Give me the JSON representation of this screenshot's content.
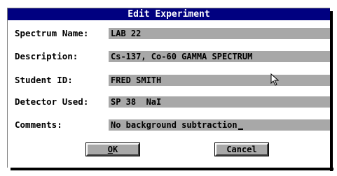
{
  "dialog": {
    "title": "Edit Experiment"
  },
  "fields": [
    {
      "label": "Spectrum Name:",
      "value": "LAB 22"
    },
    {
      "label": "Description:",
      "value": "Cs-137, Co-60 GAMMA SPECTRUM"
    },
    {
      "label": "Student ID:",
      "value": "FRED SMITH"
    },
    {
      "label": "Detector Used:",
      "value": "SP 38  NaI"
    },
    {
      "label": "Comments:",
      "value": "No background subtraction"
    }
  ],
  "buttons": {
    "ok_accel": "O",
    "ok_rest": "K",
    "cancel_label": "Cancel"
  },
  "icons": {
    "mouse_pointer": "arrow-cursor-icon"
  },
  "colors": {
    "title_bar": "#000080",
    "field_bg": "#a8a8a8",
    "button_bg": "#a8a8a8"
  }
}
